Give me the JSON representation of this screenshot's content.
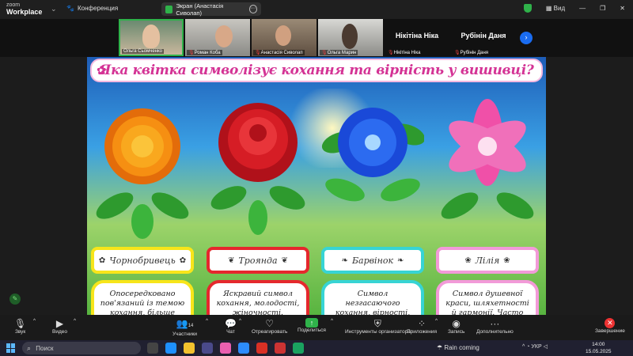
{
  "app": {
    "logo_line1": "zoom",
    "logo_line2": "Workplace",
    "conference_label": "Конференция",
    "share_pill_label": "Экран (Анастасія Сиволап)",
    "view_label": "Вид"
  },
  "participants": [
    {
      "name": "Ольга Сьомченко"
    },
    {
      "name": "Роман Коба"
    },
    {
      "name": "Анастасія Сиволап"
    },
    {
      "name": "Ольга Марин"
    },
    {
      "name": "Нікітіна Ніка",
      "caption": "Нікітіна Ніка"
    },
    {
      "name": "Рубінін Даня",
      "caption": "Рубінін Даня"
    }
  ],
  "slide": {
    "title": "Яка квітка символізує кохання та вірність у вишивці?",
    "cards": [
      {
        "name": "Чорнобривець",
        "description": "Опосередковано пов'язаний із темою кохання, більше усособлює зв'язок із рідною землею, ніжність матері, турботу."
      },
      {
        "name": "Троянда",
        "description": "Яскравий символ кохання, молодості, жіночності. Вишивали для збереження жіночої привабливості та щасливого кохання."
      },
      {
        "name": "Барвінок",
        "description": "Символ незгасаючого кохання, вірності, життя й безсмертя. Його часто вплітали у весільні вишивки та вінки."
      },
      {
        "name": "Лілія",
        "description": "Символ душевної краси, шляхетності й гармонії. Часто прикрашала вишивки на дівочих сорочках як знак чистоти помислів і ніжності."
      }
    ]
  },
  "toolbar": {
    "audio": "Звук",
    "video": "Видео",
    "participants": "Участники",
    "participants_count": "14",
    "chat": "Чат",
    "react": "Отреагировать",
    "share": "Поделиться",
    "host_tools": "Инструменты организатора",
    "apps": "Приложения",
    "record": "Запись",
    "more": "Дополнительно",
    "end": "Завершение"
  },
  "taskbar": {
    "search_placeholder": "Поиск",
    "weather": "Rain coming",
    "language": "УКР",
    "time": "14:00",
    "date": "15.05.2025"
  },
  "colors": {
    "title_pink": "#d43395",
    "marigold_border": "#f7e51a",
    "rose_border": "#e5282d",
    "periwinkle_border": "#37d4d4",
    "lily_border": "#f29ad8",
    "share_green": "#2fb24a",
    "end_red": "#e33333"
  }
}
